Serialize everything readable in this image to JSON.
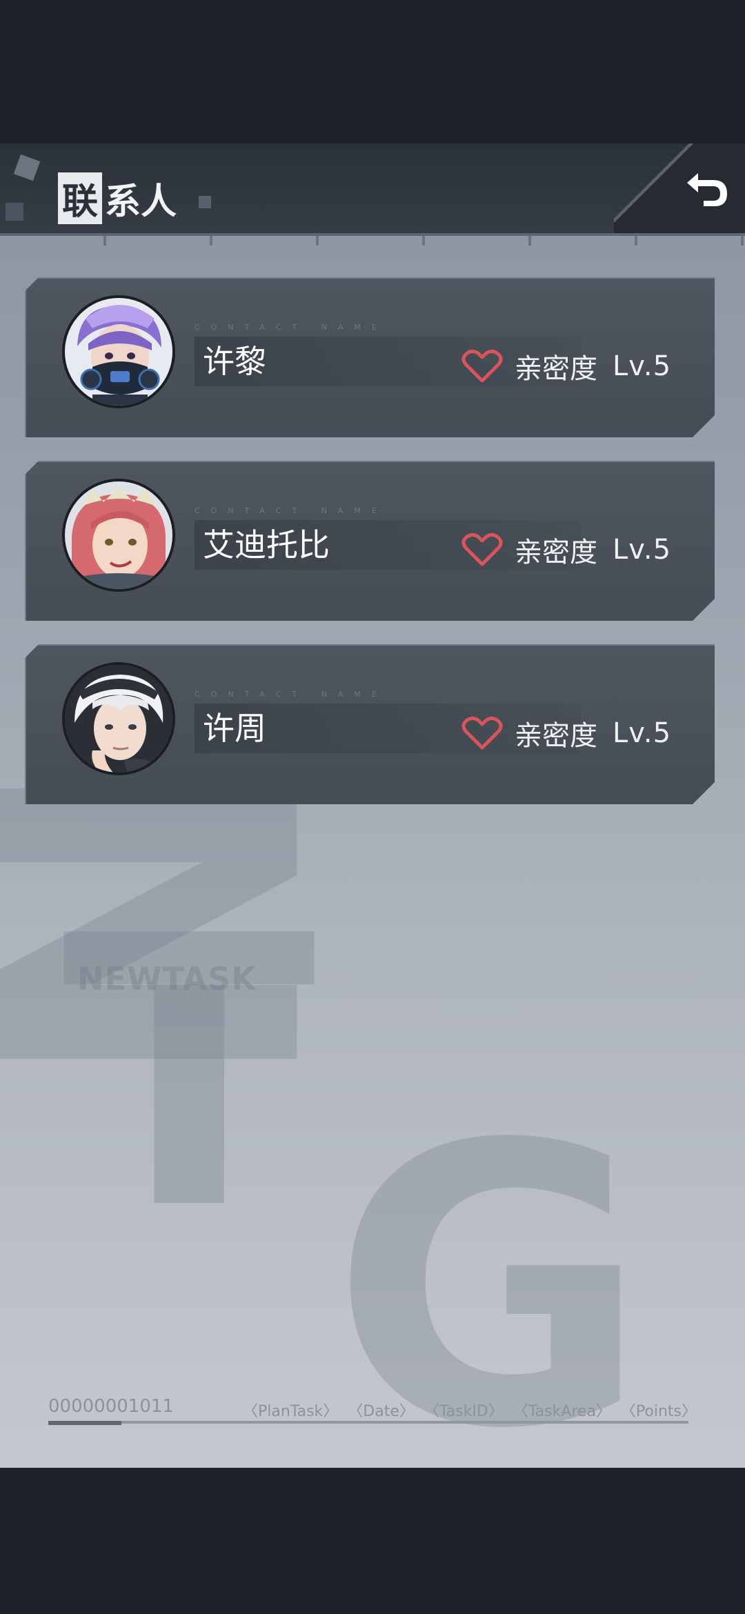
{
  "header": {
    "title_highlight": "联",
    "title_rest": "系人",
    "back_icon": "return-arrow-icon"
  },
  "contacts": [
    {
      "name": "许黎",
      "caption": "CONTACT NAME",
      "intimacy_label": "亲密度",
      "level": "Lv.5",
      "avatar_icon": "avatar-xu-li"
    },
    {
      "name": "艾迪托比",
      "caption": "CONTACT NAME",
      "intimacy_label": "亲密度",
      "level": "Lv.5",
      "avatar_icon": "avatar-eddie-toby"
    },
    {
      "name": "许周",
      "caption": "CONTACT NAME",
      "intimacy_label": "亲密度",
      "level": "Lv.5",
      "avatar_icon": "avatar-xu-zhou"
    }
  ],
  "watermark": {
    "label": "NEWTASK"
  },
  "footer": {
    "code": "00000001011",
    "tags": [
      "〈PlanTask〉",
      "〈Date〉",
      "〈TaskID〉",
      "〈TaskArea〉",
      "〈Points〉"
    ]
  },
  "colors": {
    "heart": "#d8555c",
    "card_bg": "#4b525b",
    "background": "#1f2329"
  }
}
